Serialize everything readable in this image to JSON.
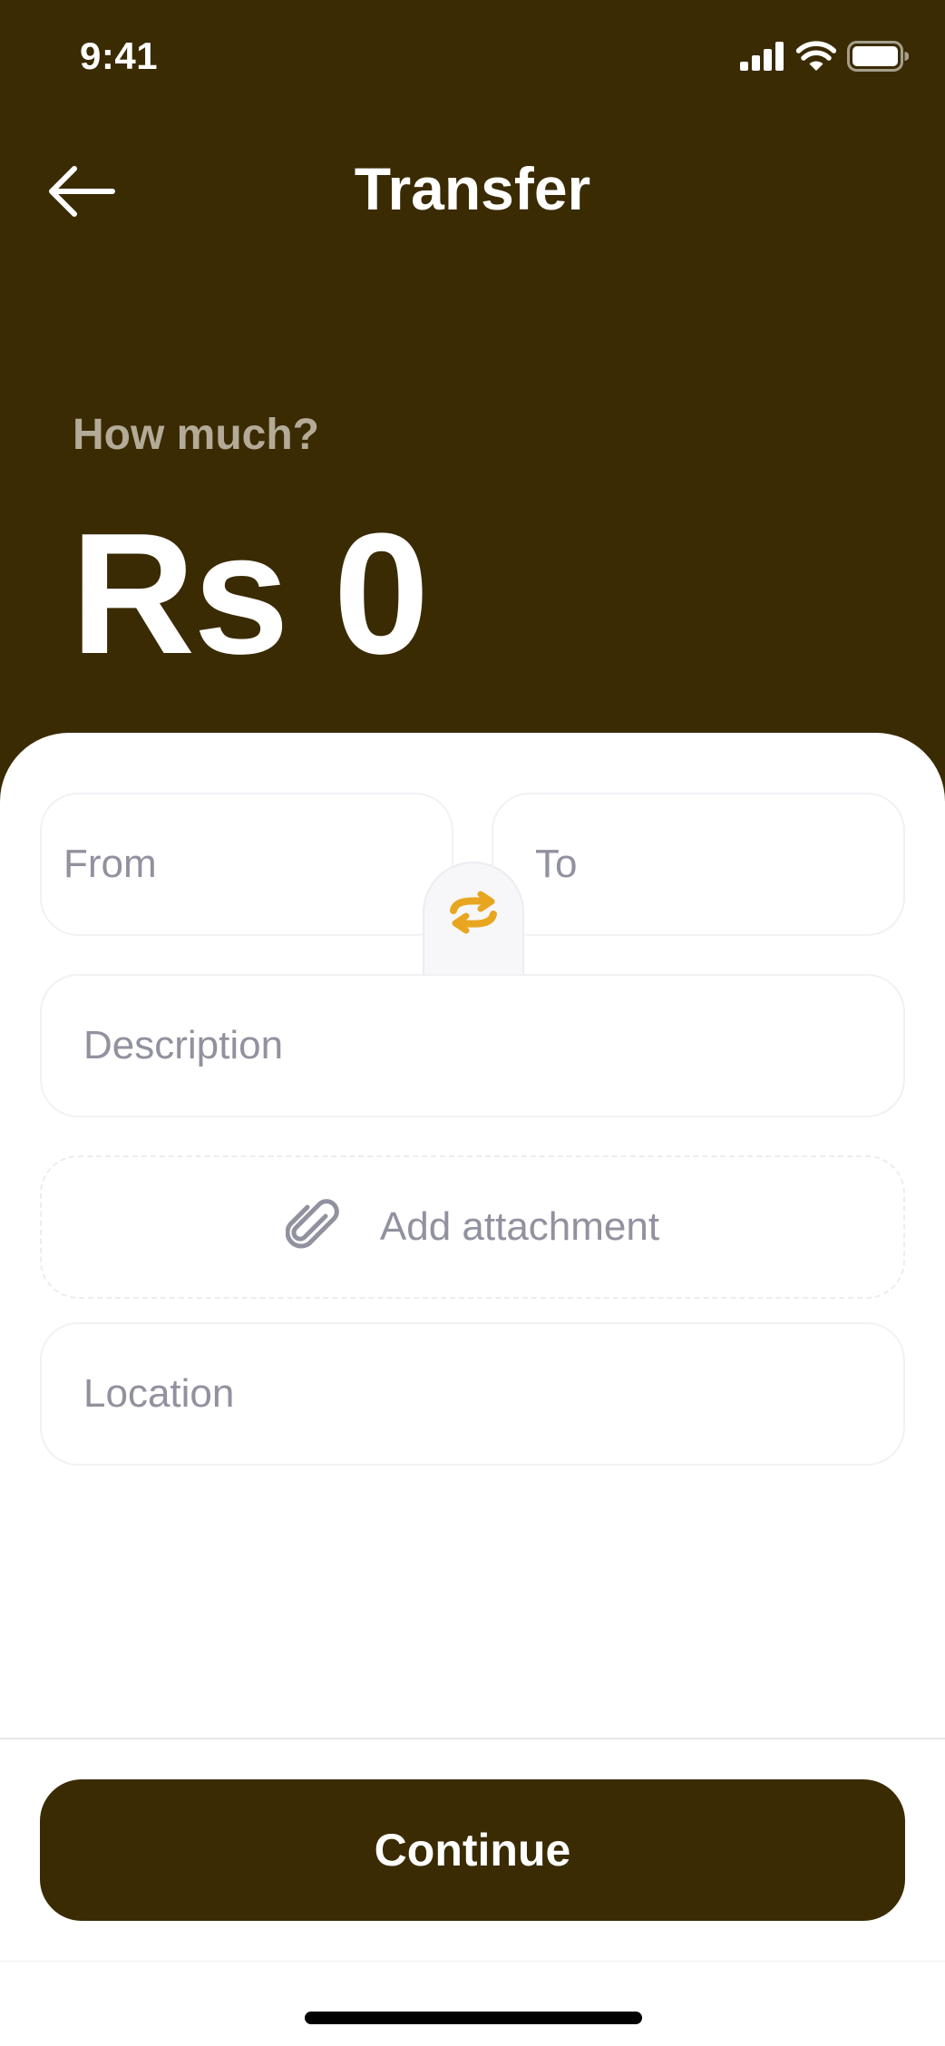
{
  "status_bar": {
    "time": "9:41",
    "icons": [
      "cellular-signal-icon",
      "wifi-icon",
      "battery-icon"
    ]
  },
  "header": {
    "title": "Transfer",
    "back_icon": "arrow-left-icon"
  },
  "amount": {
    "label": "How much?",
    "value": "Rs 0"
  },
  "form": {
    "from_placeholder": "From",
    "to_placeholder": "To",
    "swap_icon": "swap-arrows-icon",
    "description_placeholder": "Description",
    "attachment_label": "Add attachment",
    "attachment_icon": "paperclip-icon",
    "location_placeholder": "Location"
  },
  "actions": {
    "continue_label": "Continue"
  },
  "colors": {
    "brand_dark": "#3a2b03",
    "accent": "#e8a620",
    "placeholder": "#91919f",
    "label_muted": "#b3ab97"
  }
}
